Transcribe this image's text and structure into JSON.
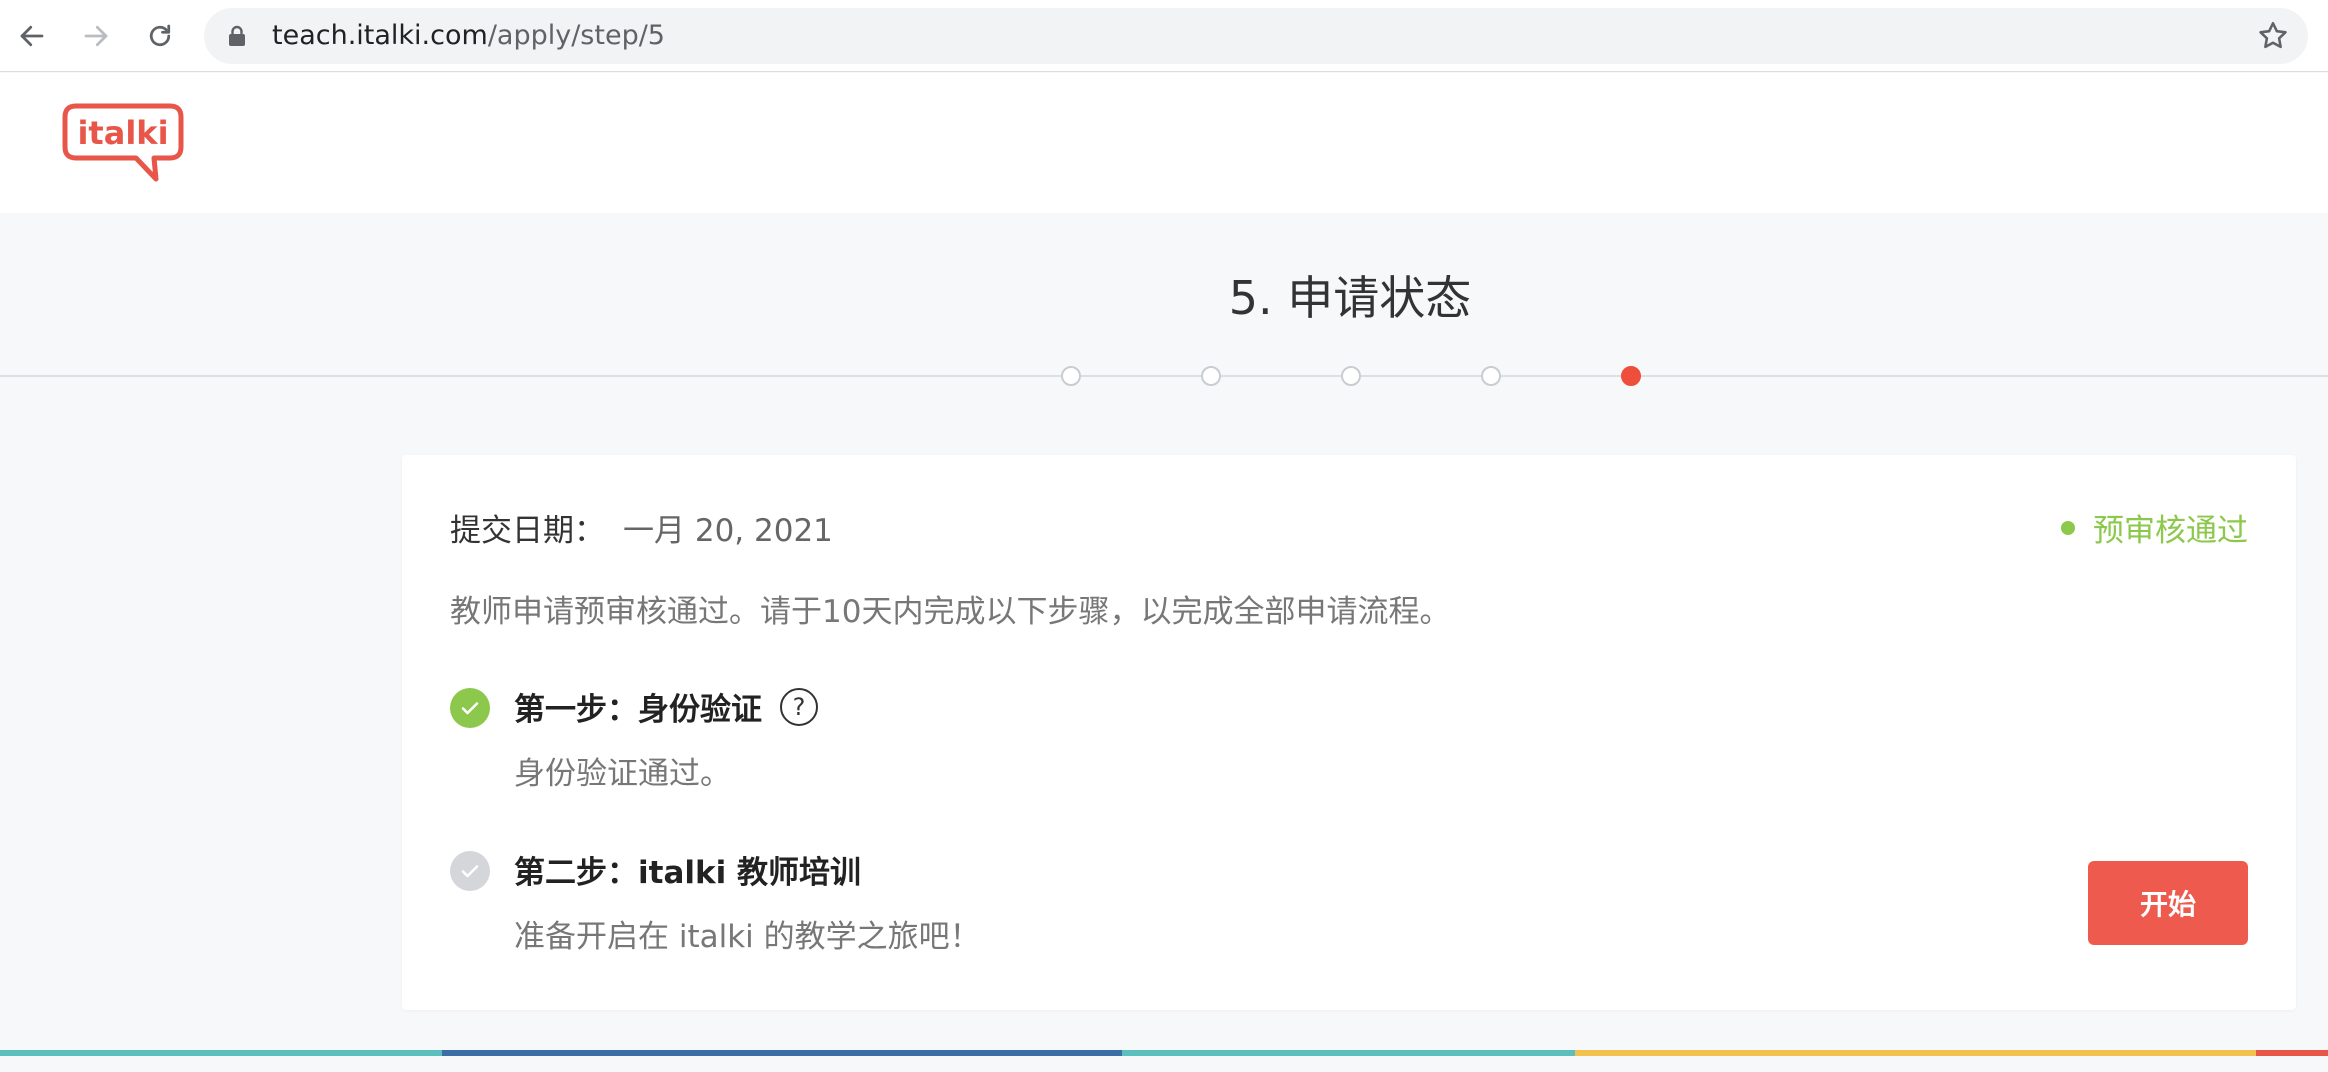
{
  "browser": {
    "url_host": "teach.italki.com",
    "url_path": "/apply/step/5"
  },
  "header": {
    "logo_text": "italki"
  },
  "progress": {
    "title": "5. 申请状态",
    "total_steps": 5,
    "current_step": 5
  },
  "application": {
    "submit_label": "提交日期：",
    "submit_date": "一月 20, 2021",
    "status": "预审核通过",
    "notice": "教师申请预审核通过。请于10天内完成以下步骤，以完成全部申请流程。",
    "steps": [
      {
        "title": "第一步：身份验证",
        "description": "身份验证通过。",
        "state": "done",
        "help_symbol": "?"
      },
      {
        "title": "第二步：italki 教师培训",
        "description": "准备开启在 italki 的教学之旅吧！",
        "state": "pending",
        "action_label": "开始"
      }
    ]
  },
  "colors": {
    "accent": "#ee4e3c",
    "button": "#ee5a4d",
    "success": "#8cc84b",
    "pending": "#d4d6d9",
    "stripe": [
      "#5bbfbd",
      "#3a6ea5",
      "#5bbfbd",
      "#f2c14e",
      "#e8564a"
    ]
  }
}
